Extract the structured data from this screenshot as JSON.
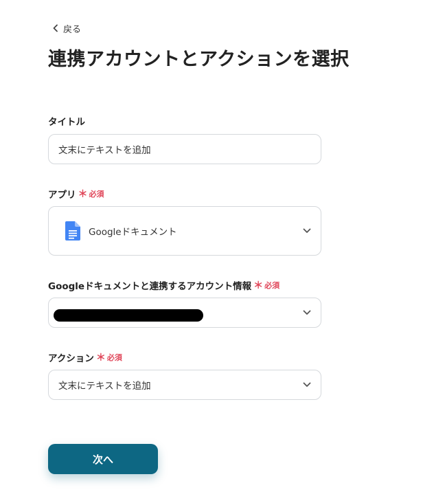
{
  "back": {
    "label": "戻る"
  },
  "page_title": "連携アカウントとアクションを選択",
  "required_label": "必須",
  "required_marker": "＊",
  "title_field": {
    "label": "タイトル",
    "value": "文末にテキストを追加"
  },
  "app_field": {
    "label": "アプリ",
    "value": "Googleドキュメント",
    "icon": "google-docs-icon"
  },
  "account_field": {
    "label": "Googleドキュメントと連携するアカウント情報",
    "value_redacted": true
  },
  "action_field": {
    "label": "アクション",
    "value": "文末にテキストを追加"
  },
  "next_button": {
    "label": "次へ"
  },
  "colors": {
    "primary": "#0d6783",
    "required": "#e0475a",
    "border": "#d5d8dc",
    "docs_blue": "#4285f4"
  }
}
